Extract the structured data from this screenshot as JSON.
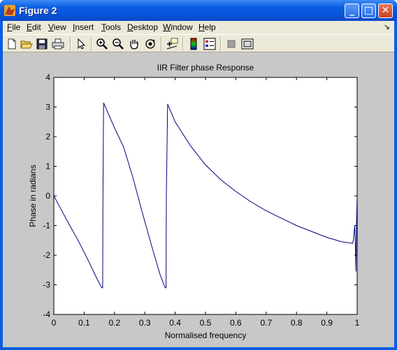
{
  "window": {
    "title": "Figure 2",
    "controls": {
      "minimize": "_",
      "maximize": "□",
      "close": "✕"
    }
  },
  "menu": {
    "items": [
      "File",
      "Edit",
      "View",
      "Insert",
      "Tools",
      "Desktop",
      "Window",
      "Help"
    ],
    "dock": "↘"
  },
  "toolbar": {
    "icons": [
      "new-file-icon",
      "open-folder-icon",
      "save-icon",
      "print-icon",
      "arrow-select-icon",
      "zoom-in-icon",
      "zoom-out-icon",
      "pan-hand-icon",
      "rotate-3d-icon",
      "data-cursor-icon",
      "colorbar-icon",
      "legend-icon",
      "hide-plot-tools-icon",
      "show-plot-tools-icon"
    ]
  },
  "colors": {
    "line": "#00007f",
    "figure_bg": "#c8c8c8",
    "axes_bg": "#ffffff",
    "titlebar": "#0a5ee4"
  },
  "chart_data": {
    "type": "line",
    "title": "IIR Filter phase Response",
    "xlabel": "Normalised frequency",
    "ylabel": "Phase in radians",
    "xlim": [
      0,
      1
    ],
    "ylim": [
      -4,
      4
    ],
    "xticks": [
      "0",
      "0.1",
      "0.2",
      "0.3",
      "0.4",
      "0.5",
      "0.6",
      "0.7",
      "0.8",
      "0.9",
      "1"
    ],
    "yticks": [
      "4",
      "3",
      "2",
      "1",
      "0",
      "-1",
      "-2",
      "-3",
      "-4"
    ],
    "grid": false,
    "series": [
      {
        "x": [
          0,
          0.02,
          0.05,
          0.08,
          0.11,
          0.14,
          0.158,
          0.161,
          0.162,
          0.164,
          0.17,
          0.2,
          0.23,
          0.26,
          0.29,
          0.32,
          0.35,
          0.367,
          0.37,
          0.371,
          0.375,
          0.4,
          0.45,
          0.5,
          0.55,
          0.6,
          0.65,
          0.7,
          0.75,
          0.8,
          0.85,
          0.9,
          0.95,
          0.985,
          0.988,
          0.99,
          0.992,
          0.994,
          0.996,
          0.998,
          1.0
        ],
        "y": [
          0,
          -0.38,
          -0.95,
          -1.5,
          -2.1,
          -2.75,
          -3.1,
          -3.1,
          0,
          3.14,
          3.0,
          2.3,
          1.65,
          0.65,
          -0.5,
          -1.6,
          -2.65,
          -3.1,
          -3.1,
          0,
          3.1,
          2.5,
          1.7,
          1.05,
          0.55,
          0.15,
          -0.2,
          -0.5,
          -0.75,
          -1.0,
          -1.2,
          -1.4,
          -1.55,
          -1.6,
          -1.45,
          -1.2,
          -1.0,
          -1.6,
          -2.55,
          -0.9,
          0
        ]
      }
    ]
  }
}
